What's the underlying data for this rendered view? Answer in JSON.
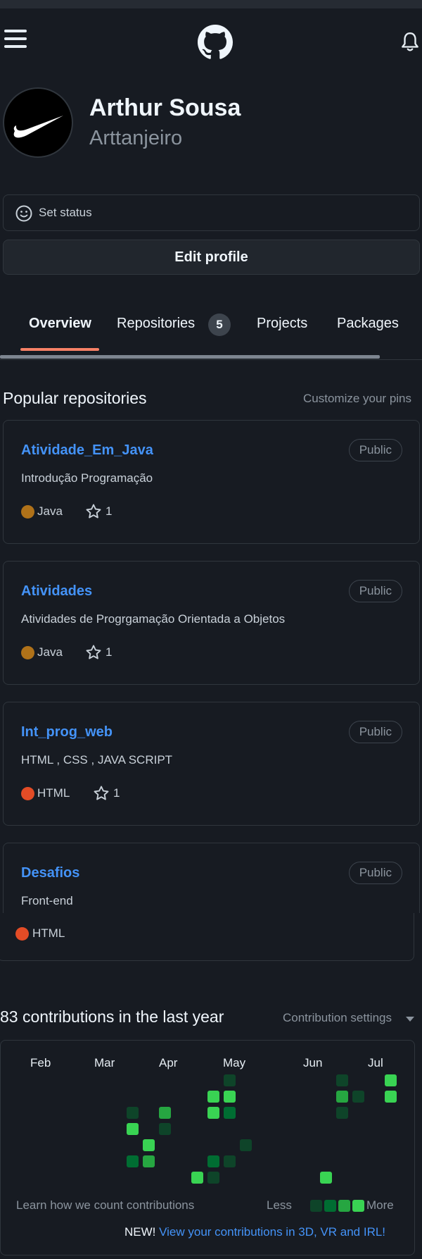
{
  "header": {
    "menu_icon": "hamburger-icon",
    "logo_icon": "github-logo-icon",
    "notification_icon": "bell-icon"
  },
  "profile": {
    "name": "Arthur Sousa",
    "login": "Arttanjeiro",
    "avatar_icon": "nike-swoosh-logo",
    "status_label": "Set status",
    "edit_label": "Edit profile"
  },
  "tabs": [
    {
      "label": "Overview",
      "active": true
    },
    {
      "label": "Repositories",
      "count": "5"
    },
    {
      "label": "Projects"
    },
    {
      "label": "Packages"
    }
  ],
  "popular": {
    "title": "Popular repositories",
    "customize": "Customize your pins",
    "repos": [
      {
        "name": "Atividade_Em_Java",
        "visibility": "Public",
        "description": "Introdução Programação",
        "language": "Java",
        "language_color": "#b07219",
        "stars": "1"
      },
      {
        "name": "Atividades",
        "visibility": "Public",
        "description": "Atividades de Progrgamação Orientada a Objetos",
        "language": "Java",
        "language_color": "#b07219",
        "stars": "1"
      },
      {
        "name": "Int_prog_web",
        "visibility": "Public",
        "description": "HTML , CSS , JAVA SCRIPT",
        "language": "HTML",
        "language_color": "#e34c26",
        "stars": "1"
      },
      {
        "name": "Desafios",
        "visibility": "Public",
        "description": "Front-end",
        "language": "HTML",
        "language_color": "#e34c26"
      }
    ]
  },
  "contributions": {
    "title": "83 contributions in the last year",
    "settings": "Contribution settings",
    "months": [
      "Feb",
      "Mar",
      "Apr",
      "May",
      "Jun",
      "Jul"
    ],
    "learn": "Learn how we count contributions",
    "less": "Less",
    "more": "More",
    "new_prefix": "NEW!",
    "new_link": "View your contributions in 3D, VR and IRL!",
    "colors": {
      "l1": "#0e4429",
      "l2": "#006d32",
      "l3": "#26a641",
      "l4": "#39d353"
    }
  }
}
